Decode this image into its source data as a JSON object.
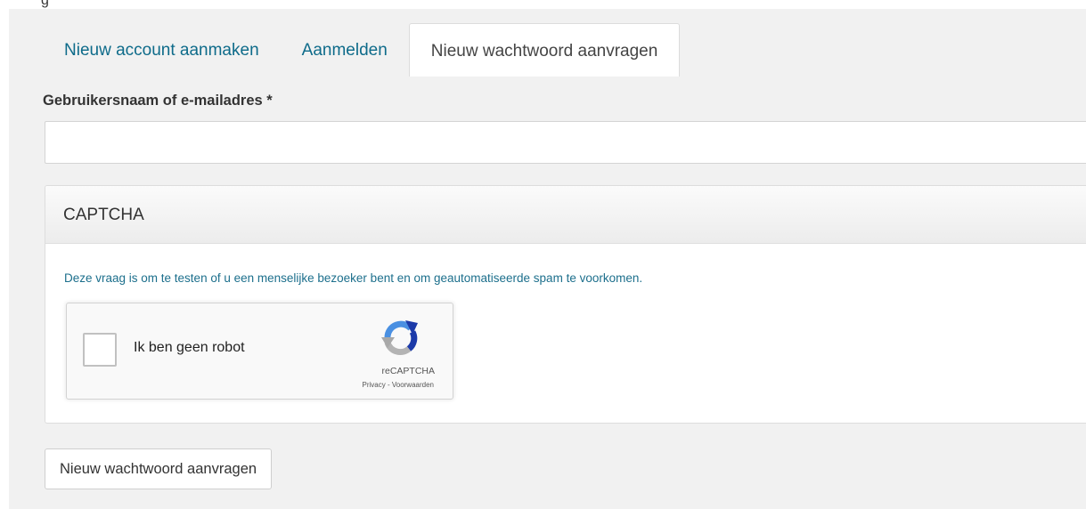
{
  "top_partial_text": "g",
  "tabs": [
    {
      "label": "Nieuw account aanmaken",
      "active": false
    },
    {
      "label": "Aanmelden",
      "active": false
    },
    {
      "label": "Nieuw wachtwoord aanvragen",
      "active": true
    }
  ],
  "form": {
    "username_label": "Gebruikersnaam of e-mailadres *",
    "username_value": "",
    "username_placeholder": ""
  },
  "captcha": {
    "title": "CAPTCHA",
    "description": "Deze vraag is om te testen of u een menselijke bezoeker bent en om geautomatiseerde spam te voorkomen.",
    "checkbox_label": "Ik ben geen robot",
    "checked": false,
    "brand": "reCAPTCHA",
    "privacy": "Privacy",
    "separator": " - ",
    "terms": "Voorwaarden"
  },
  "submit_label": "Nieuw wachtwoord aanvragen",
  "colors": {
    "link_blue": "#0e6b8a",
    "panel_bg": "#f1f1f1",
    "recaptcha_blue": "#1c3aa9",
    "recaptcha_light_blue": "#4a90e2",
    "recaptcha_gray": "#b3b3b3"
  },
  "icons": {
    "recaptcha_logo": "recaptcha-logo-icon"
  }
}
